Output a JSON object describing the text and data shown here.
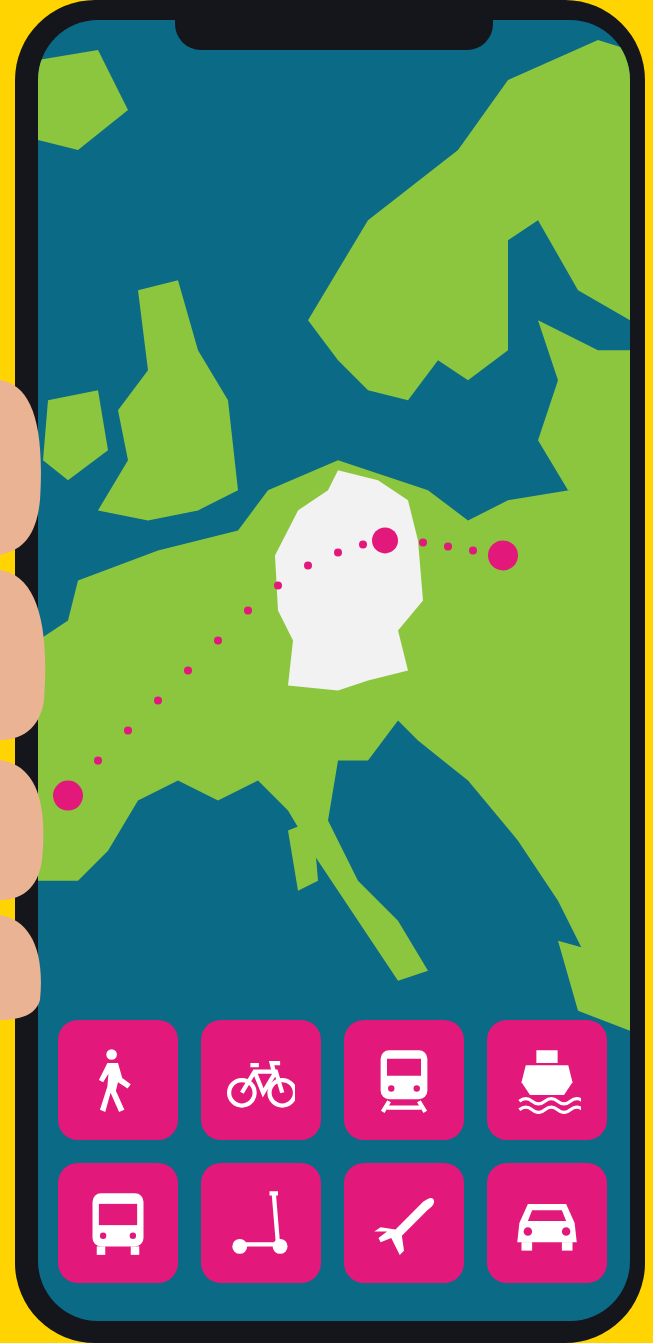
{
  "mode_buttons": [
    {
      "kind": "walk"
    },
    {
      "kind": "bike"
    },
    {
      "kind": "train"
    },
    {
      "kind": "ship"
    },
    {
      "kind": "bus"
    },
    {
      "kind": "scooter"
    },
    {
      "kind": "plane"
    },
    {
      "kind": "car"
    }
  ]
}
